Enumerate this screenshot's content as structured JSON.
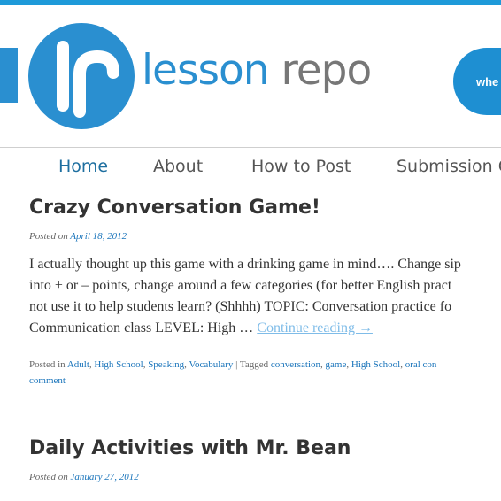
{
  "site": {
    "logo_word1": "lesson",
    "logo_word2": "repo",
    "tagline": "whe",
    "brand_color": "#1e9ad9"
  },
  "nav": {
    "items": [
      "Home",
      "About",
      "How to Post",
      "Submission G"
    ],
    "active": "Home"
  },
  "posts": [
    {
      "title": "Crazy Conversation Game!",
      "posted_on_label": "Posted on",
      "date": "April 18, 2012",
      "excerpt_lines": [
        "I actually thought up this game with a drinking game in mind…. Change sip",
        "into + or – points, change around a few categories (for better English pract",
        "not use it to help students learn?  (Shhhh) TOPIC: Conversation practice fo",
        "Communication class LEVEL: High … "
      ],
      "continue_label": "Continue reading →",
      "posted_in_label": "Posted in",
      "categories": [
        "Adult",
        "High School",
        "Speaking",
        "Vocabulary"
      ],
      "tagged_label": "| Tagged",
      "tags": [
        "conversation",
        "game",
        "High School",
        "oral con"
      ],
      "comment_label": "comment"
    },
    {
      "title": "Daily Activities with Mr. Bean",
      "posted_on_label": "Posted on",
      "date": "January 27, 2012"
    }
  ]
}
